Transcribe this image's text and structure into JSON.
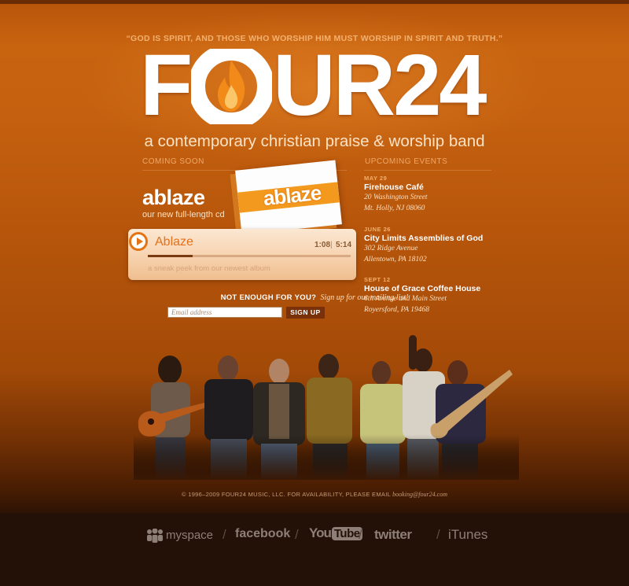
{
  "header": {
    "quote": "“GOD IS SPIRIT, AND THOSE WHO WORSHIP HIM MUST WORSHIP IN SPIRIT AND TRUTH.”",
    "logo_left": "F",
    "logo_right": "UR24",
    "tagline": "a contemporary christian praise & worship band"
  },
  "coming_soon": {
    "label": "COMING SOON",
    "album_title": "ablaze",
    "album_sub": "our new full-length cd",
    "cover_text": "ablaze"
  },
  "player": {
    "track": "Ablaze",
    "current_time": "1:08",
    "total_time": "5:14",
    "progress": 0.22,
    "caption": "a sneak peek from our newest album"
  },
  "mailing": {
    "prompt": "NOT ENOUGH FOR YOU?",
    "link": "Sign up for our mailing list!",
    "placeholder": "Email address",
    "button": "SIGN UP"
  },
  "events": {
    "label": "UPCOMING EVENTS",
    "items": [
      {
        "date": "MAY 29",
        "venue": "Firehouse Café",
        "addr1": "20 Washington Street",
        "addr2": "Mt. Holly, NJ 08060"
      },
      {
        "date": "JUNE 26",
        "venue": "City Limits Assemblies of God",
        "addr1": "302 Ridge Avenue",
        "addr2": "Allentown, PA 18102"
      },
      {
        "date": "SEPT 12",
        "venue": "House of Grace Coffee House",
        "addr1": "6th Avenue and Main Street",
        "addr2": "Royersford, PA 19468"
      }
    ]
  },
  "footer": {
    "copyright": "© 1996–2009 FOUR24 MUSIC, LLC. FOR AVAILABILITY, PLEASE EMAIL",
    "email": "booking@four24.com",
    "links": {
      "myspace": "myspace",
      "facebook": "facebook",
      "youtube_you": "You",
      "youtube_tube": "Tube",
      "twitter": "twitter",
      "itunes": "iTunes"
    }
  },
  "colors": {
    "accent": "#e47413",
    "background": "#c4600f",
    "footer": "#231006"
  },
  "icons": {
    "logo_flame": "flame-icon",
    "play": "play-icon",
    "myspace": "myspace-people-icon"
  }
}
